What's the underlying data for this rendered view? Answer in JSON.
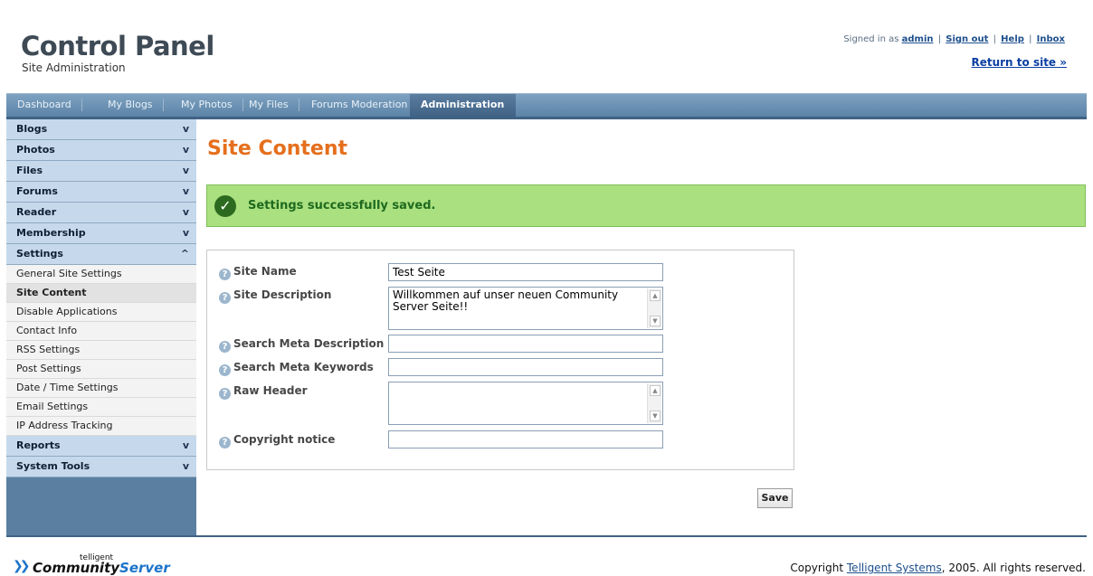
{
  "header": {
    "title": "Control Panel",
    "subtitle": "Site Administration",
    "signed_in_prefix": "Signed in as",
    "username": "admin",
    "sign_out": "Sign out",
    "help": "Help",
    "inbox": "Inbox",
    "separator": "|",
    "return_link": "Return to site »"
  },
  "tabs": [
    {
      "label": "Dashboard"
    },
    {
      "label": "My Blogs"
    },
    {
      "label": "My Photos"
    },
    {
      "label": "My Files"
    },
    {
      "label": "Forums Moderation"
    },
    {
      "label": "Administration",
      "active": true
    }
  ],
  "sidebar": {
    "sections_top": [
      {
        "label": "Blogs"
      },
      {
        "label": "Photos"
      },
      {
        "label": "Files"
      },
      {
        "label": "Forums"
      },
      {
        "label": "Reader"
      },
      {
        "label": "Membership"
      }
    ],
    "settings": {
      "label": "Settings",
      "items": [
        {
          "label": "General Site Settings"
        },
        {
          "label": "Site Content",
          "active": true
        },
        {
          "label": "Disable Applications"
        },
        {
          "label": "Contact Info"
        },
        {
          "label": "RSS Settings"
        },
        {
          "label": "Post Settings"
        },
        {
          "label": "Date / Time Settings"
        },
        {
          "label": "Email Settings"
        },
        {
          "label": "IP Address Tracking"
        }
      ]
    },
    "sections_bottom": [
      {
        "label": "Reports"
      },
      {
        "label": "System Tools"
      }
    ],
    "chevron_down": "v",
    "chevron_up": "^"
  },
  "main": {
    "title": "Site Content",
    "success_message": "Settings successfully saved.",
    "fields": {
      "site_name": {
        "label": "Site Name",
        "value": "Test Seite"
      },
      "site_description": {
        "label": "Site Description",
        "value": "Willkommen auf unser neuen Community Server Seite!!"
      },
      "search_meta_description": {
        "label": "Search Meta Description",
        "value": ""
      },
      "search_meta_keywords": {
        "label": "Search Meta Keywords",
        "value": ""
      },
      "raw_header": {
        "label": "Raw Header",
        "value": ""
      },
      "copyright_notice": {
        "label": "Copyright notice",
        "value": ""
      }
    },
    "save_label": "Save"
  },
  "footer": {
    "logo_small": "telligent",
    "logo_main": "Community",
    "logo_server": "Server",
    "copyright_prefix": "Copyright",
    "company": "Telligent Systems",
    "copyright_suffix": ", 2005. All rights reserved."
  },
  "colors": {
    "accent": "#e56f1d",
    "tabbar": "#5c84a8",
    "success_bg": "#aae07f",
    "sidebar_head": "#c6d9ec"
  }
}
